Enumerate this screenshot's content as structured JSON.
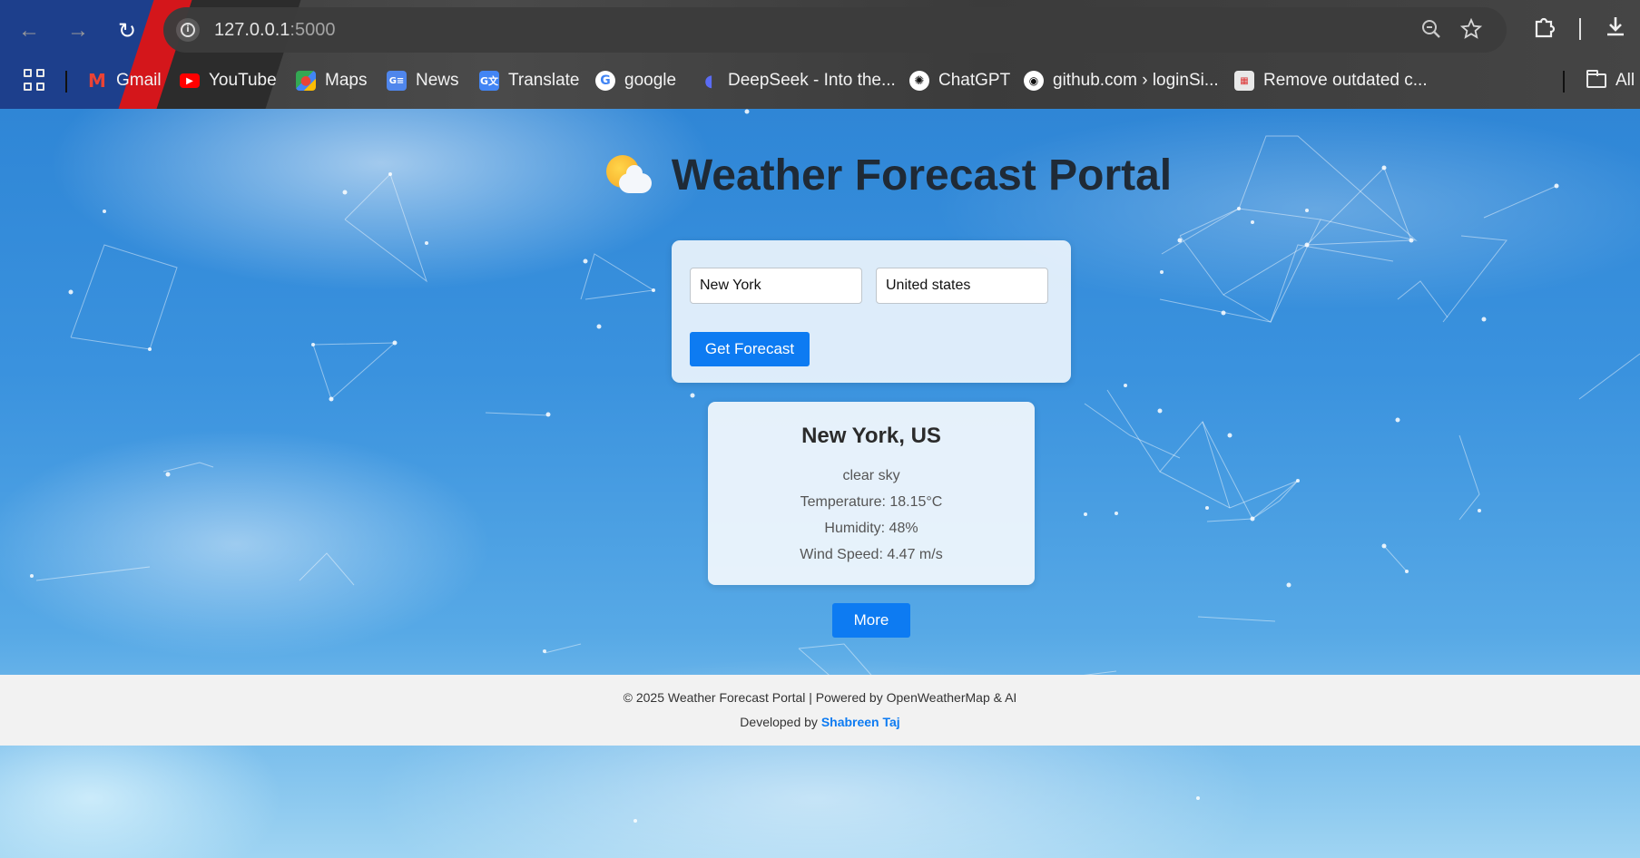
{
  "browser": {
    "url_host": "127.0.0.1",
    "url_port": ":5000",
    "bookmarks": [
      {
        "label": "Gmail",
        "icon": "gmail-icon"
      },
      {
        "label": "YouTube",
        "icon": "youtube-icon"
      },
      {
        "label": "Maps",
        "icon": "maps-icon"
      },
      {
        "label": "News",
        "icon": "news-icon"
      },
      {
        "label": "Translate",
        "icon": "translate-icon"
      },
      {
        "label": "google",
        "icon": "google-icon"
      },
      {
        "label": "DeepSeek - Into the...",
        "icon": "deepseek-icon"
      },
      {
        "label": "ChatGPT",
        "icon": "chatgpt-icon"
      },
      {
        "label": "github.com › loginSi...",
        "icon": "github-icon"
      },
      {
        "label": "Remove outdated c...",
        "icon": "store-icon"
      }
    ],
    "all_bookmarks_label": "All"
  },
  "page": {
    "title": "Weather Forecast Portal",
    "search": {
      "city_value": "New York",
      "country_value": "United states",
      "submit_label": "Get Forecast"
    },
    "result": {
      "location": "New York, US",
      "description": "clear sky",
      "temperature": "Temperature: 18.15°C",
      "humidity": "Humidity: 48%",
      "wind": "Wind Speed: 4.47 m/s"
    },
    "more_label": "More",
    "footer": {
      "line1": "© 2025 Weather Forecast Portal | Powered by OpenWeatherMap & AI",
      "developed_by": "Developed by",
      "developer": "Shabreen Taj"
    }
  },
  "colors": {
    "accent": "#0d7bf2",
    "title": "#1f2a36",
    "footer_bg": "#f2f2f2"
  }
}
